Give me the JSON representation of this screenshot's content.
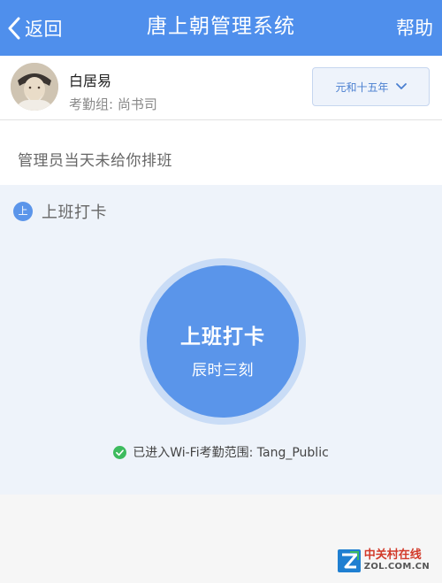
{
  "nav": {
    "back_label": "返回",
    "title": "唐上朝管理系统",
    "help_label": "帮助"
  },
  "user": {
    "name": "白居易",
    "group": "考勤组: 尚书司"
  },
  "date_selector": {
    "value": "元和十五年"
  },
  "notice": "管理员当天未给你排班",
  "checkin": {
    "step_badge": "上",
    "step_label": "上班打卡",
    "button_title": "上班打卡",
    "button_time": "辰时三刻",
    "wifi_status": "已进入Wi-Fi考勤范围: Tang_Public"
  },
  "watermark": {
    "line1": "中关村在线",
    "line2": "ZOL.COM.CN"
  },
  "colors": {
    "nav_blue": "#4f8fec",
    "button_blue": "#5a95ea",
    "panel_bg": "#eef3fa",
    "success_green": "#3dbb5e"
  },
  "icons": {
    "back": "chevron-left-icon",
    "dropdown": "chevron-down-icon",
    "wifi_ok": "check-circle-icon",
    "avatar": "portrait-image"
  }
}
